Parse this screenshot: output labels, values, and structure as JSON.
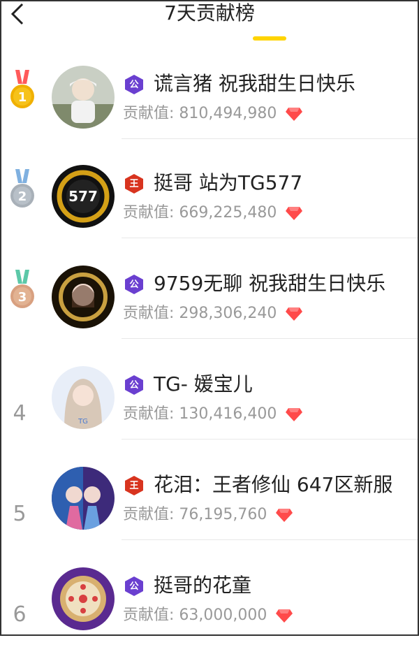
{
  "header": {
    "title": "7天贡献榜"
  },
  "colors": {
    "accent": "#ffd400",
    "gold": "#f0b000",
    "silver": "#a8b0b8",
    "bronze": "#d8a080",
    "tag_purple": "#6a3fd0",
    "tag_red": "#d8341f",
    "diamond": "#ff4a4a"
  },
  "list": {
    "contrib_label": "贡献值:",
    "items": [
      {
        "rank": "1",
        "medal": "gold",
        "tag": "公",
        "tag_color": "purple",
        "name": "谎言猪 祝我甜生日快乐",
        "value": "810,494,980"
      },
      {
        "rank": "2",
        "medal": "silver",
        "tag": "王",
        "tag_color": "red",
        "name": "挺哥 站为TG577",
        "value": "669,225,480"
      },
      {
        "rank": "3",
        "medal": "bronze",
        "tag": "公",
        "tag_color": "purple",
        "name": "9759无聊 祝我甜生日快乐",
        "value": "298,306,240"
      },
      {
        "rank": "4",
        "medal": "",
        "tag": "公",
        "tag_color": "purple",
        "name": "TG- 媛宝儿",
        "value": "130,416,400"
      },
      {
        "rank": "5",
        "medal": "",
        "tag": "王",
        "tag_color": "red",
        "name": "花泪：王者修仙 647区新服",
        "value": "76,195,760"
      },
      {
        "rank": "6",
        "medal": "",
        "tag": "公",
        "tag_color": "purple",
        "name": "挺哥的花童",
        "value": "63,000,000"
      }
    ]
  }
}
